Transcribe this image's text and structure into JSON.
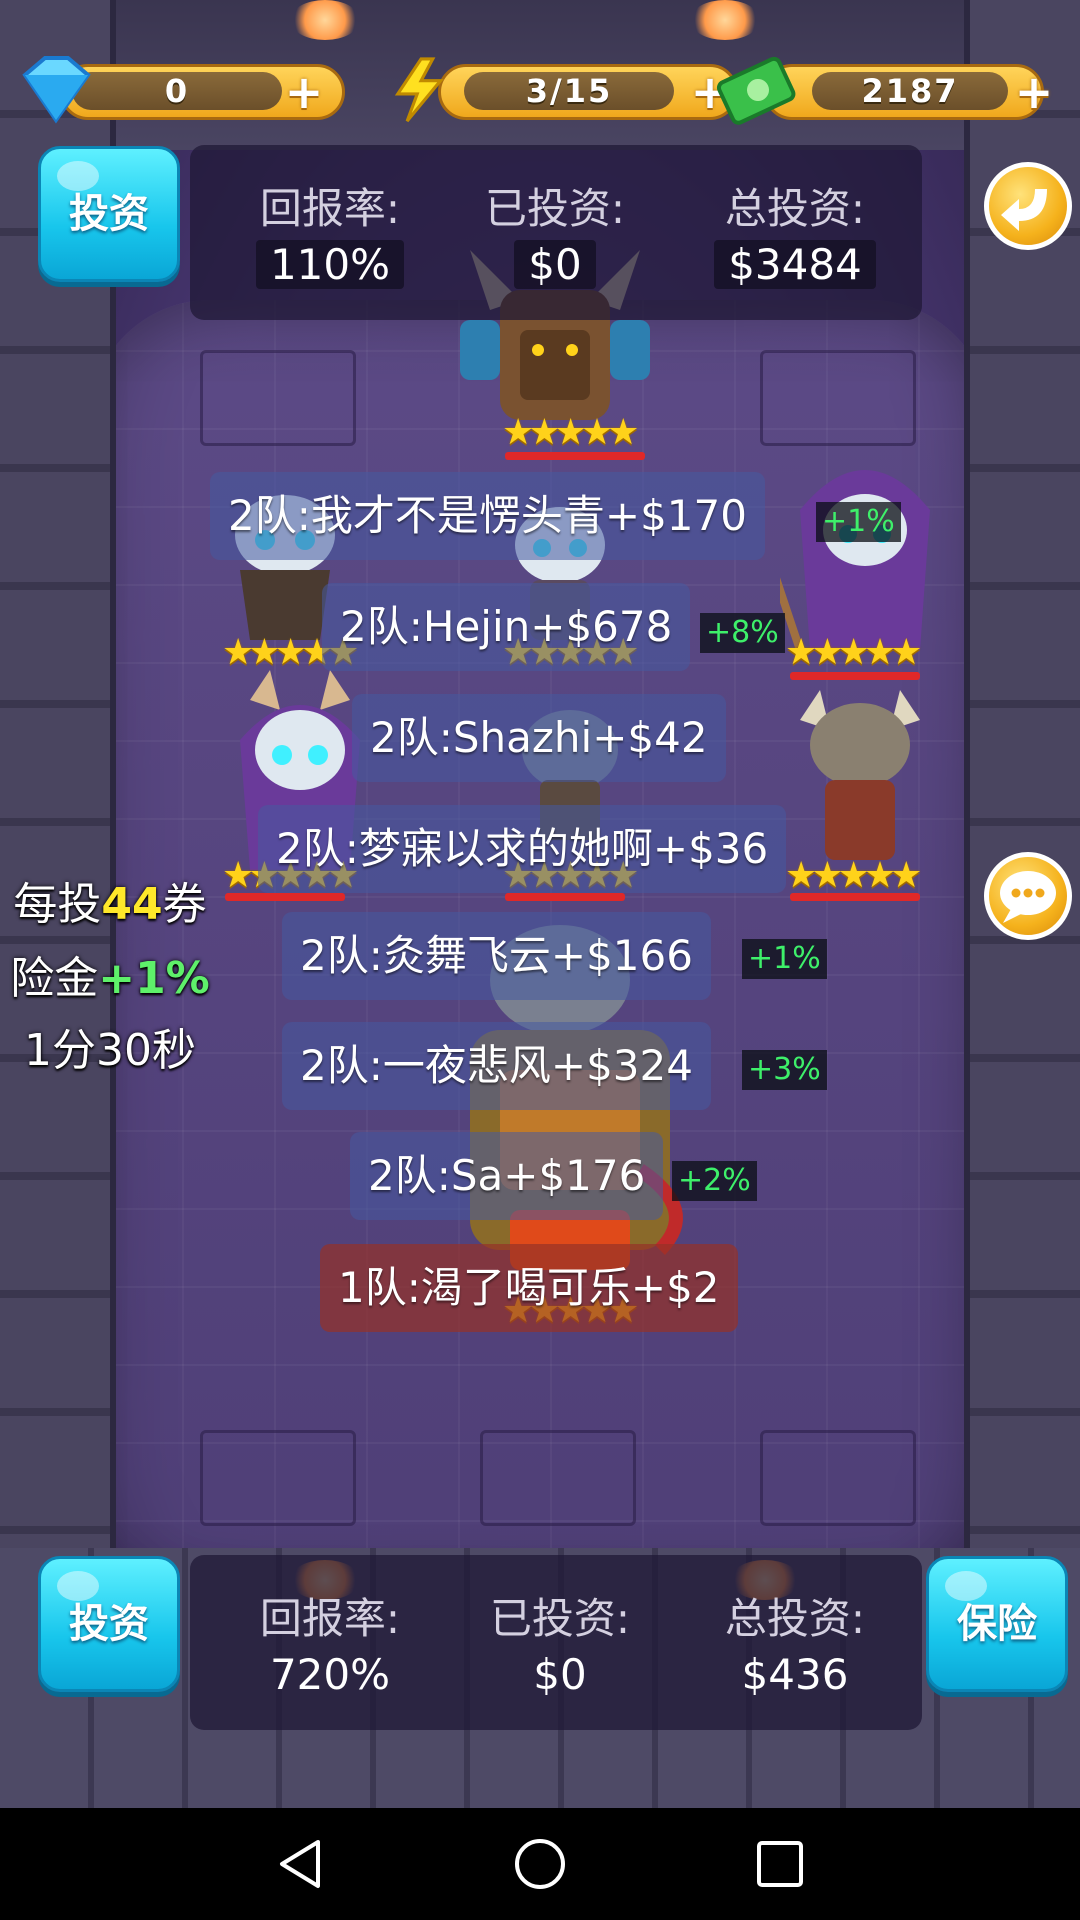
{
  "resources": {
    "gems": "0",
    "energy": "3/15",
    "cash": "2187",
    "gem_icon": "diamond-icon",
    "energy_icon": "lightning-icon",
    "cash_icon": "money-icon",
    "plus": "+"
  },
  "top_panel": {
    "invest_label": "投资",
    "return_rate_label": "回报率:",
    "return_rate": "110%",
    "invested_label": "已投资:",
    "invested": "$0",
    "total_label": "总投资:",
    "total": "$3484"
  },
  "feed": [
    {
      "text": "2队:我才不是愣头青+$170",
      "bonus": "+1%"
    },
    {
      "text": "2队:Hejin+$678",
      "bonus": "+8%"
    },
    {
      "text": "2队:Shazhi+$42",
      "bonus": ""
    },
    {
      "text": "2队:梦寐以求的她啊+$36",
      "bonus": ""
    },
    {
      "text": "2队:灸舞飞云+$166",
      "bonus": "+1%"
    },
    {
      "text": "2队:一夜悲风+$324",
      "bonus": "+3%"
    },
    {
      "text": "2队:Sa+$176",
      "bonus": "+2%"
    },
    {
      "text": "1队:渴了喝可乐+$2",
      "bonus": ""
    }
  ],
  "side_info": {
    "per_bet_prefix": "每投",
    "per_bet_value": "44",
    "per_bet_suffix": "券",
    "insurance_prefix": "险金",
    "insurance_value": "+1%",
    "timer": "1分30秒"
  },
  "bottom_panel": {
    "invest_label": "投资",
    "return_rate_label": "回报率:",
    "return_rate": "720%",
    "invested_label": "已投资:",
    "invested": "$0",
    "total_label": "总投资:",
    "total": "$436",
    "insurance_label": "保险"
  },
  "stars": "★★★★★",
  "colors": {
    "accent_cyan": "#18c6ec",
    "gold": "#ffd45a",
    "bonus_green": "#3ef06a"
  }
}
